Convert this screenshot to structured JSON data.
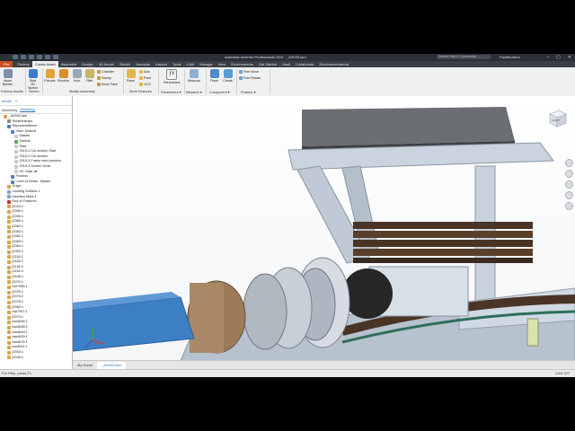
{
  "window": {
    "title": "Autodesk Inventor Professional 2019 - _A4S93.iam",
    "search_placeholder": "Search Help & Commands...",
    "user": "PaulMunford",
    "controls": [
      "–",
      "▢",
      "✕"
    ]
  },
  "ribbon": {
    "file_label": "File",
    "tabs": [
      "Factory",
      "Create Asset",
      "Assemble",
      "Design",
      "3D Model",
      "Sketch",
      "Annotate",
      "Inspect",
      "Tools",
      "CAM",
      "Manage",
      "View",
      "Environments",
      "Get Started",
      "Vault",
      "Collaborate",
      "Electromechanical"
    ],
    "active_tab": "Create Asset",
    "buttons": {
      "asset_builder": "Asset Builder",
      "start_2d_sketch": "Start 2D Sketch",
      "extrude": "Extrude",
      "revolve": "Revolve",
      "hole": "Hole",
      "fillet": "Fillet",
      "chamfer": "Chamfer",
      "sweep": "Sweep",
      "move_face": "Move Face",
      "axis": "Axis",
      "point": "Point",
      "ucs": "UCS",
      "plane": "Plane",
      "parameters": "Parameters",
      "measure": "Measure",
      "place": "Place",
      "create": "Create",
      "free_move": "Free Move",
      "free_rotate": "Free Rotate"
    },
    "panels": [
      "Factory Assets",
      "Sketch",
      "Modify Assembly",
      "Work Features",
      "Parameters ▾",
      "Measure ▾",
      "Component ▾",
      "Position ▾"
    ]
  },
  "browser": {
    "tabs": [
      "Model",
      "+"
    ],
    "subtabs": [
      "Assembly",
      "Modeling"
    ],
    "active_subtab": "Modeling",
    "items": [
      {
        "label": "_A4S93.iam",
        "indent": 1,
        "color": "#d9a441",
        "selected": false
      },
      {
        "label": "Relationships",
        "indent": 2,
        "color": "#8a8a8a",
        "selected": false
      },
      {
        "label": "Representations",
        "indent": 2,
        "color": "#4f7fbf",
        "selected": false
      },
      {
        "label": "View: Default",
        "indent": 3,
        "color": "#4f7fbf",
        "selected": false
      },
      {
        "label": "Master",
        "indent": 4,
        "color": "#c9c9c9",
        "selected": false
      },
      {
        "label": "Default",
        "indent": 4,
        "color": "#5aa35a",
        "selected": false
      },
      {
        "label": "Start",
        "indent": 4,
        "color": "#c9c9c9",
        "selected": false
      },
      {
        "label": "2019-1 Cut section Start",
        "indent": 4,
        "color": "#c9c9c9",
        "selected": false
      },
      {
        "label": "2019-2 Cut section",
        "indent": 4,
        "color": "#c9c9c9",
        "selected": false
      },
      {
        "label": "2019-3 Frame start position",
        "indent": 4,
        "color": "#c9c9c9",
        "selected": false
      },
      {
        "label": "2019-3 Screen Grab",
        "indent": 4,
        "color": "#c9c9c9",
        "selected": false
      },
      {
        "label": "HC Gate off",
        "indent": 4,
        "color": "#c9c9c9",
        "selected": false
      },
      {
        "label": "Position",
        "indent": 3,
        "color": "#4f7fbf",
        "selected": false
      },
      {
        "label": "Level of Detail : Master",
        "indent": 3,
        "color": "#4f7fbf",
        "selected": false
      },
      {
        "label": "Origin",
        "indent": 2,
        "color": "#d9a441",
        "selected": false
      },
      {
        "label": "Landing Surface:1",
        "indent": 2,
        "color": "#7fa3c8",
        "selected": false
      },
      {
        "label": "Insertion Mark:1",
        "indent": 2,
        "color": "#7fa3c8",
        "selected": false
      },
      {
        "label": "End of Features",
        "indent": 2,
        "color": "#c0392b",
        "selected": false
      },
      {
        "label": "j2019:1",
        "indent": 2,
        "color": "#d9a441",
        "selected": false
      },
      {
        "label": "j2090:1",
        "indent": 2,
        "color": "#d9a441",
        "selected": false
      },
      {
        "label": "j2095:1",
        "indent": 2,
        "color": "#d9a441",
        "selected": false
      },
      {
        "label": "j2060:1",
        "indent": 2,
        "color": "#d9a441",
        "selected": false
      },
      {
        "label": "j2062:1",
        "indent": 2,
        "color": "#d9a441",
        "selected": false
      },
      {
        "label": "j2063:1",
        "indent": 2,
        "color": "#d9a441",
        "selected": false
      },
      {
        "label": "j2061:1",
        "indent": 2,
        "color": "#d9a441",
        "selected": false
      },
      {
        "label": "j2083:1",
        "indent": 2,
        "color": "#d9a441",
        "selected": false
      },
      {
        "label": "j2064:1",
        "indent": 2,
        "color": "#d9a441",
        "selected": false
      },
      {
        "label": "j2052:1",
        "indent": 2,
        "color": "#d9a441",
        "selected": false
      },
      {
        "label": "j2118:1",
        "indent": 2,
        "color": "#d9a441",
        "selected": false
      },
      {
        "label": "j2118:2",
        "indent": 2,
        "color": "#d9a441",
        "selected": false
      },
      {
        "label": "j2118:3",
        "indent": 2,
        "color": "#d9a441",
        "selected": false
      },
      {
        "label": "j2118:4",
        "indent": 2,
        "color": "#d9a441",
        "selected": false
      },
      {
        "label": "j2108:1",
        "indent": 2,
        "color": "#d9a441",
        "selected": false
      },
      {
        "label": "j2070:1",
        "indent": 2,
        "color": "#d9a441",
        "selected": false
      },
      {
        "label": "bar7956:1",
        "indent": 2,
        "color": "#d9a441",
        "selected": false
      },
      {
        "label": "j2076:1",
        "indent": 2,
        "color": "#d9a441",
        "selected": false
      },
      {
        "label": "j2076:2",
        "indent": 2,
        "color": "#d9a441",
        "selected": false
      },
      {
        "label": "j2075:1",
        "indent": 2,
        "color": "#d9a441",
        "selected": false
      },
      {
        "label": "j2083:1",
        "indent": 2,
        "color": "#d9a441",
        "selected": false
      },
      {
        "label": "bar7957:1",
        "indent": 2,
        "color": "#d9a441",
        "selected": false
      },
      {
        "label": "j2079:1",
        "indent": 2,
        "color": "#d9a441",
        "selected": false
      },
      {
        "label": "bar4638:1",
        "indent": 2,
        "color": "#d9a441",
        "selected": false
      },
      {
        "label": "bar4638:2",
        "indent": 2,
        "color": "#d9a441",
        "selected": false
      },
      {
        "label": "bar4640:1",
        "indent": 2,
        "color": "#d9a441",
        "selected": false
      },
      {
        "label": "bar4639:1",
        "indent": 2,
        "color": "#d9a441",
        "selected": false
      },
      {
        "label": "bar4676:1",
        "indent": 2,
        "color": "#d9a441",
        "selected": false
      },
      {
        "label": "bar4631:1",
        "indent": 2,
        "color": "#d9a441",
        "selected": false
      },
      {
        "label": "j2016:1",
        "indent": 2,
        "color": "#d9a441",
        "selected": false
      },
      {
        "label": "j2045:1",
        "indent": 2,
        "color": "#d9a441",
        "selected": false
      }
    ]
  },
  "viewport": {
    "doc_tabs": [
      "My Home",
      "_A4S93.iam"
    ],
    "active_doc_tab": "_A4S93.iam",
    "viewcube_label": "FRONT"
  },
  "status": {
    "message": "For Help, press F1",
    "counts": "1118    227"
  }
}
